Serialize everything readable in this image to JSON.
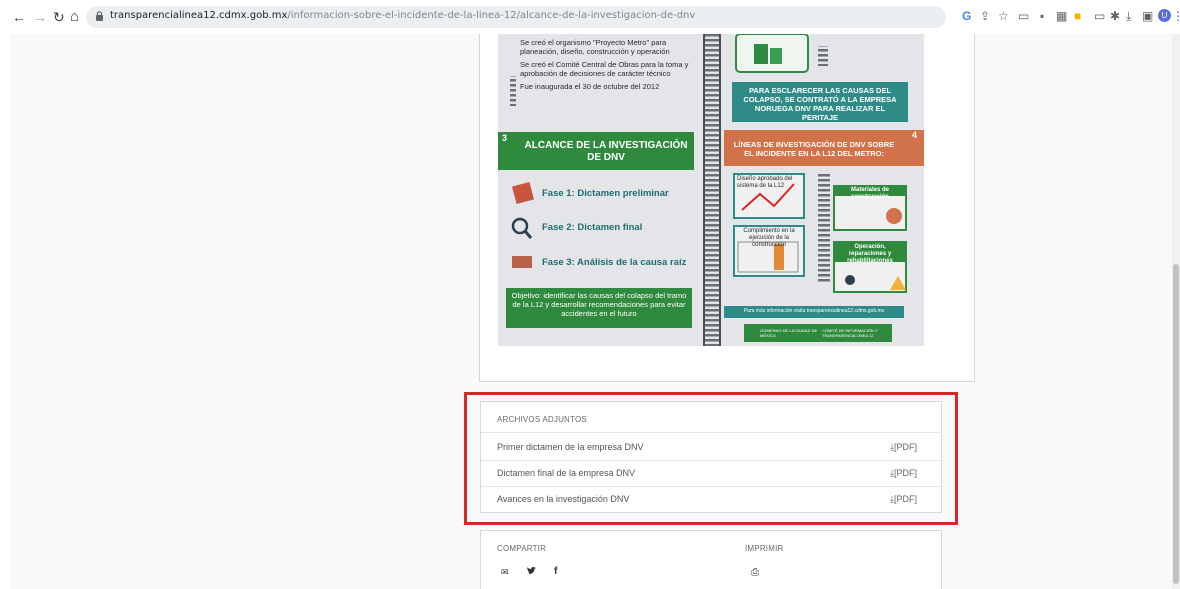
{
  "browser": {
    "back_glyph": "←",
    "forward_glyph": "→",
    "reload_glyph": "↻",
    "home_glyph": "⌂",
    "lock_glyph": "🔒",
    "url_host": "transparencialinea12.cdmx.gob.mx",
    "url_path": "/informacion-sobre-el-incidente-de-la-linea-12/alcance-de-la-investigacion-de-dnv",
    "menu_glyph": "⋮",
    "profile_initial": "U"
  },
  "infographic": {
    "bullets": [
      "Se creó el organismo \"Proyecto Metro\" para planeación, diseño, construcción y operación",
      "Se creó el Comité Central de Obras para la toma y aprobación de decisiones de carácter técnico",
      "Fue inaugurada el 30 de octubre del 2012"
    ],
    "dnv_note": "PARA ESCLARECER LAS CAUSAS DEL COLAPSO, SE CONTRATÓ A LA EMPRESA NORUEGA DNV PARA REALIZAR EL PERITAJE",
    "section3_number": "3",
    "section3_title": "ALCANCE DE LA INVESTIGACIÓN DE DNV",
    "section4_number": "4",
    "section4_title": "LÍNEAS DE INVESTIGACIÓN DE DNV SOBRE EL INCIDENTE EN LA L12 DEL METRO:",
    "phases": [
      "Fase 1: Dictamen preliminar",
      "Fase 2: Dictamen final",
      "Fase 3: Análisis de la causa raíz"
    ],
    "objective": "Objetivo: identificar las causas del colapso del tramo de la L12 y desarrollar recomendaciones para evitar accidentes en el futuro",
    "lines": [
      "Diseño aprobado del sistema de la L12",
      "Materiales de construcción",
      "Cumplimiento en la ejecución de la construcción",
      "Operación, reparaciones y rehabilitaciones"
    ],
    "more_info": "Para más información visita transparencialinea12.cdmx.gob.mx",
    "footer_left": "GOBIERNO DE LA CIUDAD DE MÉXICO",
    "footer_right": "COMITÉ DE INFORMACIÓN Y TRANSPARENCIA LÍNEA 12"
  },
  "attachments": {
    "title": "ARCHIVOS ADJUNTOS",
    "items": [
      {
        "label": "Primer dictamen de la empresa DNV",
        "link": "[PDF]"
      },
      {
        "label": "Dictamen final de la empresa DNV",
        "link": "[PDF]"
      },
      {
        "label": "Avances en la investigación DNV",
        "link": "[PDF]"
      }
    ]
  },
  "share": {
    "title": "COMPARTIR",
    "print_title": "IMPRIMIR"
  }
}
